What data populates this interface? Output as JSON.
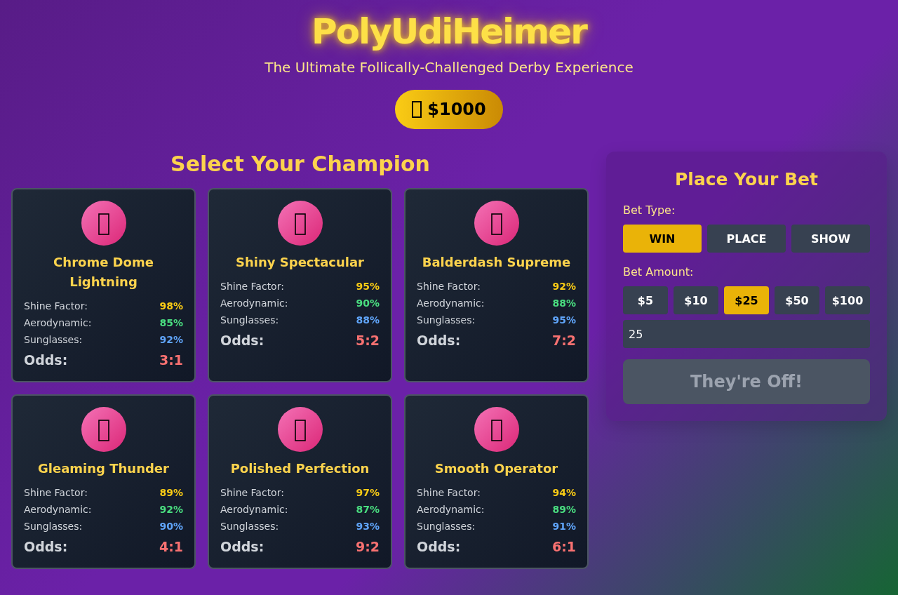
{
  "header": {
    "title": "PolyUdiHeimer",
    "subtitle": "The Ultimate Follically-Challenged Derby Experience",
    "balance": "$1000"
  },
  "champions": {
    "heading": "Select Your Champion",
    "horses": [
      {
        "name": "Chrome Dome Lightning",
        "stats": [
          {
            "label": "Shine Factor:",
            "value": "98%",
            "color": "#facc15"
          },
          {
            "label": "Aerodynamic:",
            "value": "85%",
            "color": "#4ade80"
          },
          {
            "label": "Sunglasses:",
            "value": "92%",
            "color": "#60a5fa"
          }
        ],
        "odds_label": "Odds:",
        "odds": "3:1"
      },
      {
        "name": "Shiny Spectacular",
        "stats": [
          {
            "label": "Shine Factor:",
            "value": "95%",
            "color": "#facc15"
          },
          {
            "label": "Aerodynamic:",
            "value": "90%",
            "color": "#4ade80"
          },
          {
            "label": "Sunglasses:",
            "value": "88%",
            "color": "#60a5fa"
          }
        ],
        "odds_label": "Odds:",
        "odds": "5:2"
      },
      {
        "name": "Balderdash Supreme",
        "stats": [
          {
            "label": "Shine Factor:",
            "value": "92%",
            "color": "#facc15"
          },
          {
            "label": "Aerodynamic:",
            "value": "88%",
            "color": "#4ade80"
          },
          {
            "label": "Sunglasses:",
            "value": "95%",
            "color": "#60a5fa"
          }
        ],
        "odds_label": "Odds:",
        "odds": "7:2"
      },
      {
        "name": "Gleaming Thunder",
        "stats": [
          {
            "label": "Shine Factor:",
            "value": "89%",
            "color": "#facc15"
          },
          {
            "label": "Aerodynamic:",
            "value": "92%",
            "color": "#4ade80"
          },
          {
            "label": "Sunglasses:",
            "value": "90%",
            "color": "#60a5fa"
          }
        ],
        "odds_label": "Odds:",
        "odds": "4:1"
      },
      {
        "name": "Polished Perfection",
        "stats": [
          {
            "label": "Shine Factor:",
            "value": "97%",
            "color": "#facc15"
          },
          {
            "label": "Aerodynamic:",
            "value": "87%",
            "color": "#4ade80"
          },
          {
            "label": "Sunglasses:",
            "value": "93%",
            "color": "#60a5fa"
          }
        ],
        "odds_label": "Odds:",
        "odds": "9:2"
      },
      {
        "name": "Smooth Operator",
        "stats": [
          {
            "label": "Shine Factor:",
            "value": "94%",
            "color": "#facc15"
          },
          {
            "label": "Aerodynamic:",
            "value": "89%",
            "color": "#4ade80"
          },
          {
            "label": "Sunglasses:",
            "value": "91%",
            "color": "#60a5fa"
          }
        ],
        "odds_label": "Odds:",
        "odds": "6:1"
      }
    ]
  },
  "bet_panel": {
    "title": "Place Your Bet",
    "bet_type_label": "Bet Type:",
    "bet_types": [
      {
        "label": "WIN",
        "selected": true
      },
      {
        "label": "PLACE",
        "selected": false
      },
      {
        "label": "SHOW",
        "selected": false
      }
    ],
    "amount_label": "Bet Amount:",
    "amounts": [
      {
        "label": "$5",
        "selected": false
      },
      {
        "label": "$10",
        "selected": false
      },
      {
        "label": "$25",
        "selected": true
      },
      {
        "label": "$50",
        "selected": false
      },
      {
        "label": "$100",
        "selected": false
      }
    ],
    "amount_input": {
      "value": "25"
    },
    "submit": {
      "label": "They're Off!",
      "disabled": true
    }
  }
}
